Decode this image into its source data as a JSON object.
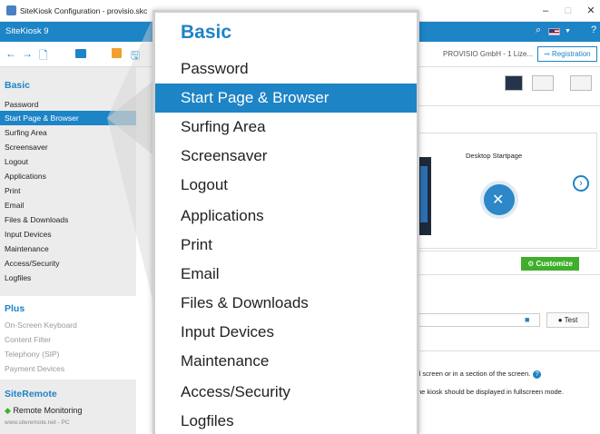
{
  "window": {
    "title": "SiteKiosk Configuration - provisio.skc",
    "minimize": "–",
    "maximize": "□",
    "close": "✕"
  },
  "appbar": {
    "app_name": "SiteKiosk 9",
    "search_icon": "search-icon",
    "flag_icon": "us-flag-icon",
    "help_icon": "help-icon"
  },
  "toolbar": {
    "icons": [
      "back-arrow-icon",
      "forward-arrow-icon",
      "new-file-icon",
      "open-folder-icon",
      "save-icon",
      "save-as-icon"
    ],
    "license_text": "PROVISIO GmbH - 1 Lize...",
    "registration_label": "Registration"
  },
  "sidebar": {
    "basic": {
      "title": "Basic",
      "items": [
        "Password",
        "Start Page & Browser",
        "Surfing Area",
        "Screensaver",
        "Logout",
        "Applications",
        "Print",
        "Email",
        "Files & Downloads",
        "Input Devices",
        "Maintenance",
        "Access/Security",
        "Logfiles"
      ],
      "active_index": 1
    },
    "plus": {
      "title": "Plus",
      "items": [
        "On-Screen Keyboard",
        "Content Filter",
        "Telephony (SIP)",
        "Payment Devices"
      ]
    },
    "siteremote": {
      "title": "SiteRemote",
      "item": "Remote Monitoring",
      "url": "www.siteremote.net - PC"
    }
  },
  "content": {
    "card_title": "Desktop Startpage",
    "customize_label": "Customize",
    "test_label": "Test",
    "info_line_1": "ll screen or in a section of the screen.",
    "info_line_2": "he kiosk should be displayed in fullscreen mode."
  },
  "popup": {
    "title": "Basic",
    "items": [
      "Password",
      "Start Page & Browser",
      "Surfing Area",
      "Screensaver",
      "Logout",
      "Applications",
      "Print",
      "Email",
      "Files & Downloads",
      "Input Devices",
      "Maintenance",
      "Access/Security",
      "Logfiles"
    ],
    "active_index": 1
  },
  "colors": {
    "accent": "#1d84c6",
    "customize": "#3fae2a"
  }
}
